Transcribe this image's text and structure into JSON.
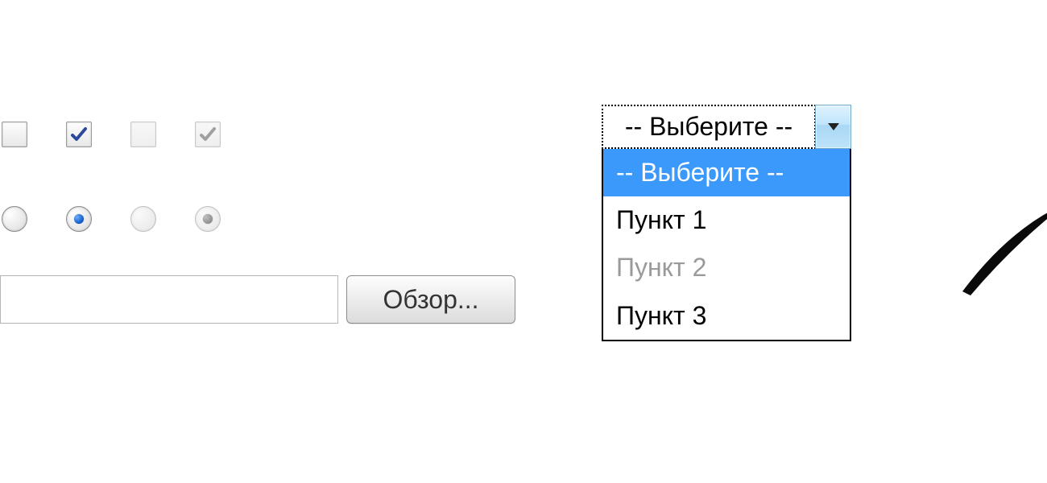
{
  "checkboxes": [
    {
      "checked": false,
      "disabled": false
    },
    {
      "checked": true,
      "disabled": false
    },
    {
      "checked": false,
      "disabled": true
    },
    {
      "checked": true,
      "disabled": true
    }
  ],
  "radios": [
    {
      "selected": false,
      "disabled": false
    },
    {
      "selected": true,
      "disabled": false
    },
    {
      "selected": false,
      "disabled": true
    },
    {
      "selected": true,
      "disabled": true
    }
  ],
  "file": {
    "value": "",
    "browse_label": "Обзор..."
  },
  "select": {
    "placeholder": "-- Выберите --",
    "selected_index": 0,
    "highlighted_index": 0,
    "options": [
      {
        "label": "-- Выберите --",
        "disabled": false,
        "placeholder": true
      },
      {
        "label": "Пункт 1",
        "disabled": false
      },
      {
        "label": "Пункт 2",
        "disabled": true
      },
      {
        "label": "Пункт 3",
        "disabled": false
      }
    ]
  }
}
